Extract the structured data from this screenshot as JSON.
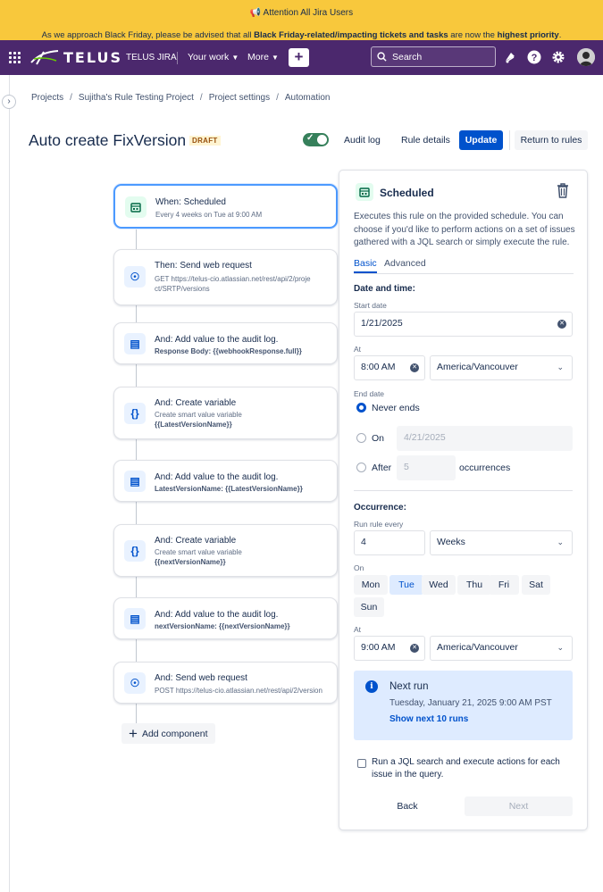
{
  "banner": {
    "title": "Attention All Jira Users",
    "msg_a": "As we approach Black Friday, please be advised that all ",
    "msg_b": "Black Friday-related/impacting tickets and tasks",
    "msg_c": " are now the ",
    "msg_d": "highest priority",
    "msg_e": ".",
    "icon": "megaphone-icon",
    "color": "#f8c83c"
  },
  "topbar": {
    "logo": "TELUS",
    "brand": "TELUS JIRA",
    "your_work": "Your work",
    "more": "More",
    "create": "+",
    "search_placeholder": "Search",
    "color": "#4b286d"
  },
  "breadcrumb": [
    "Projects",
    "Sujitha's Rule Testing Project",
    "Project settings",
    "Automation"
  ],
  "header": {
    "title": "Auto create FixVersion",
    "draft": "DRAFT",
    "toggle_on": true,
    "audit_log": "Audit log",
    "rule_details": "Rule details",
    "update": "Update",
    "return": "Return to rules"
  },
  "flow": [
    {
      "title": "When: Scheduled",
      "sub": "Every 4 weeks on Tue at 9:00 AM",
      "icon": "calendar-icon"
    },
    {
      "title": "Then: Send web request",
      "sub": "GET https://telus-cio.atlassian.net/rest/api/2/project/SRTP/versions",
      "icon": "webhook-icon"
    },
    {
      "title": "And: Add value to the audit log.",
      "sub_bold": "Response Body: {{webhookResponse.full}}",
      "icon": "document-icon"
    },
    {
      "title": "And: Create variable",
      "sub": "Create smart value variable",
      "sub_bold": "{{LatestVersionName}}",
      "icon": "braces-icon"
    },
    {
      "title": "And: Add value to the audit log.",
      "sub_bold": "LatestVersionName: {{LatestVersionName}}",
      "icon": "document-icon"
    },
    {
      "title": "And: Create variable",
      "sub": "Create smart value variable",
      "sub_bold": "{{nextVersionName}}",
      "icon": "braces-icon"
    },
    {
      "title": "And: Add value to the audit log.",
      "sub_bold": "nextVersionName: {{nextVersionName}}",
      "icon": "document-icon"
    },
    {
      "title": "And: Send web request",
      "sub": "POST https://telus-cio.atlassian.net/rest/api/2/version",
      "icon": "webhook-icon"
    }
  ],
  "add_component": "Add component",
  "panel": {
    "title": "Scheduled",
    "description": "Executes this rule on the provided schedule. You can choose if you'd like to perform actions on a set of issues gathered with a JQL search or simply execute the rule.",
    "tabs": [
      "Basic",
      "Advanced"
    ],
    "date_time_heading": "Date and time:",
    "start_date_label": "Start date",
    "start_date": "1/21/2025",
    "at_label": "At",
    "at_time": "8:00 AM",
    "timezone": "America/Vancouver",
    "end_date_label": "End date",
    "never_ends": "Never ends",
    "on_label": "On",
    "on_date": "4/21/2025",
    "after_label": "After",
    "after_count": "5",
    "occurrences": "occurrences",
    "occurrence_heading": "Occurrence:",
    "run_every_label": "Run rule every",
    "run_every_value": "4",
    "run_every_unit": "Weeks",
    "on_days_label": "On",
    "days": [
      "Mon",
      "Tue",
      "Wed",
      "Thu",
      "Fri",
      "Sat",
      "Sun"
    ],
    "selected_day": "Tue",
    "at2_label": "At",
    "at2_time": "9:00 AM",
    "timezone2": "America/Vancouver",
    "next_run_title": "Next run",
    "next_run_date": "Tuesday, January 21, 2025 9:00 AM PST",
    "show_next": "Show next 10 runs",
    "jql_label": "Run a JQL search and execute actions for each issue in the query.",
    "back": "Back",
    "next": "Next"
  }
}
